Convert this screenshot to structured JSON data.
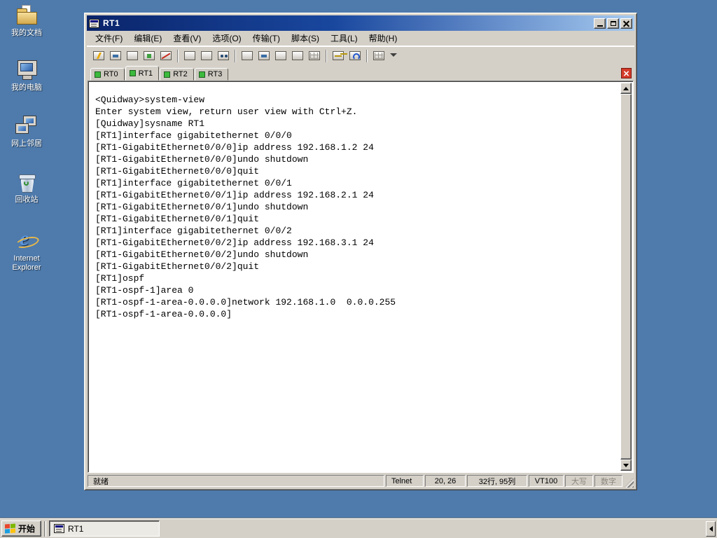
{
  "desktop": {
    "icons": [
      {
        "label": "我的文档"
      },
      {
        "label": "我的电脑"
      },
      {
        "label": "网上邻居"
      },
      {
        "label": "回收站"
      },
      {
        "label": "Internet Explorer"
      }
    ]
  },
  "window": {
    "title": "RT1",
    "menu": [
      "文件(F)",
      "编辑(E)",
      "查看(V)",
      "选项(O)",
      "传输(T)",
      "脚本(S)",
      "工具(L)",
      "帮助(H)"
    ],
    "toolbar_icons": [
      "quick-connect",
      "connect",
      "clone-session",
      "reconnect",
      "disconnect",
      "copy",
      "paste",
      "find",
      "print",
      "file-transfer",
      "send-file",
      "receive-file",
      "session-options",
      "key-agent",
      "help",
      "cascade-windows"
    ],
    "tabs": [
      "RT0",
      "RT1",
      "RT2",
      "RT3"
    ],
    "active_tab": "RT1",
    "terminal_lines": [
      "<Quidway>system-view",
      "Enter system view, return user view with Ctrl+Z.",
      "[Quidway]sysname RT1",
      "[RT1]interface gigabitethernet 0/0/0",
      "[RT1-GigabitEthernet0/0/0]ip address 192.168.1.2 24",
      "[RT1-GigabitEthernet0/0/0]undo shutdown",
      "[RT1-GigabitEthernet0/0/0]quit",
      "[RT1]interface gigabitethernet 0/0/1",
      "[RT1-GigabitEthernet0/0/1]ip address 192.168.2.1 24",
      "[RT1-GigabitEthernet0/0/1]undo shutdown",
      "[RT1-GigabitEthernet0/0/1]quit",
      "[RT1]interface gigabitethernet 0/0/2",
      "[RT1-GigabitEthernet0/0/2]ip address 192.168.3.1 24",
      "[RT1-GigabitEthernet0/0/2]undo shutdown",
      "[RT1-GigabitEthernet0/0/2]quit",
      "[RT1]ospf",
      "[RT1-ospf-1]area 0",
      "[RT1-ospf-1-area-0.0.0.0]network 192.168.1.0  0.0.0.255",
      "[RT1-ospf-1-area-0.0.0.0]"
    ],
    "statusbar": {
      "ready": "就绪",
      "protocol": "Telnet",
      "cursor_pos": "20, 26",
      "screen_size": "32行, 95列",
      "emulation": "VT100",
      "caps_lock": "大写",
      "num_lock": "数字"
    }
  },
  "taskbar": {
    "start_label": "开始",
    "tasks": [
      "RT1"
    ]
  },
  "colors": {
    "desktop_background": "#4E7AAC",
    "window_chrome": "#D4D0C8",
    "titlebar_gradient_start": "#0A246A",
    "titlebar_gradient_end": "#A6CAF0",
    "terminal_background": "#FFFFFF",
    "terminal_text": "#000000",
    "tab_connected_indicator": "#3DBA3D",
    "close_tab_red": "#D43A2A"
  }
}
